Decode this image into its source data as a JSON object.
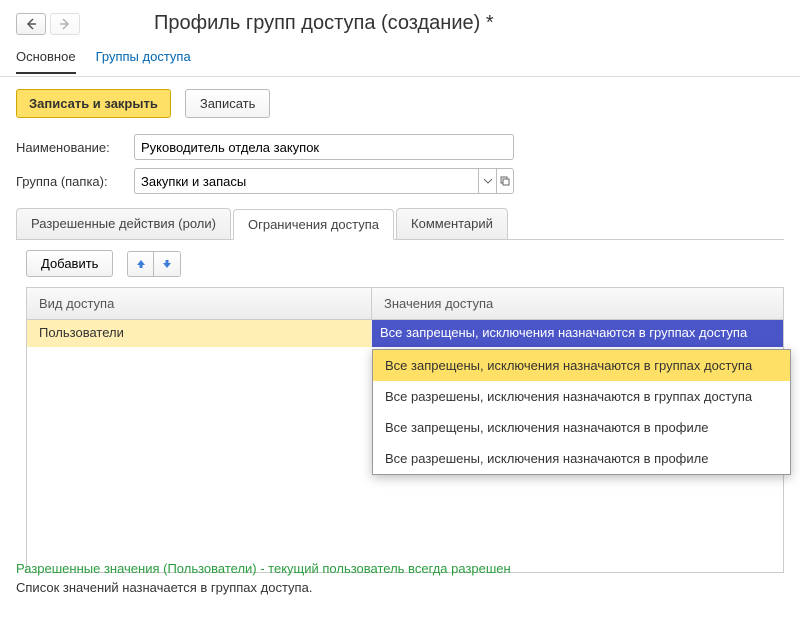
{
  "header": {
    "title": "Профиль групп доступа (создание) *"
  },
  "navlinks": {
    "main": "Основное",
    "groups": "Группы доступа"
  },
  "commands": {
    "save_close": "Записать и закрыть",
    "save": "Записать"
  },
  "form": {
    "name_label": "Наименование:",
    "name_value": "Руководитель отдела закупок",
    "group_label": "Группа (папка):",
    "group_value": "Закупки и запасы"
  },
  "tabs": {
    "roles": "Разрешенные действия (роли)",
    "restrictions": "Ограничения доступа",
    "comment": "Комментарий"
  },
  "subcommands": {
    "add": "Добавить"
  },
  "table": {
    "col1_header": "Вид доступа",
    "col2_header": "Значения доступа",
    "row1_col1": "Пользователи",
    "row1_col2": "Все запрещены, исключения назначаются в группах доступа"
  },
  "dropdown": {
    "options": [
      "Все запрещены, исключения назначаются в группах доступа",
      "Все разрешены, исключения назначаются в группах доступа",
      "Все запрещены, исключения назначаются в профиле",
      "Все разрешены, исключения назначаются в профиле"
    ]
  },
  "footer": {
    "line1": "Разрешенные значения (Пользователи) - текущий пользователь всегда разрешен",
    "line2": "Список значений назначается в группах доступа."
  }
}
